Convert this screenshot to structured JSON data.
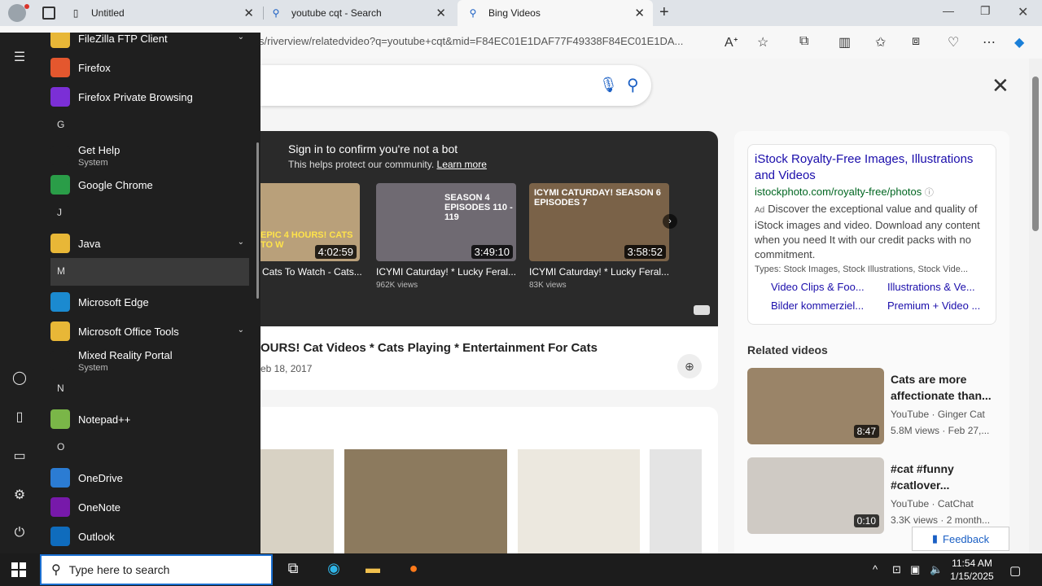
{
  "browser": {
    "tabs": [
      {
        "label": "Untitled",
        "icon": "page-icon"
      },
      {
        "label": "youtube cqt - Search",
        "icon": "search-icon"
      },
      {
        "label": "Bing Videos",
        "icon": "search-icon"
      }
    ],
    "url": "s/riverview/relatedvideo?q=youtube+cqt&mid=F84EC01E1DAF77F49338F84EC01E1DA..."
  },
  "player": {
    "bot_title": "Sign in to confirm you're not a bot",
    "bot_sub": "This helps protect our community.",
    "learn_more": "Learn more",
    "thumbs": [
      {
        "label": "EPIC 4 HOURS! CATS TO W",
        "duration": "4:02:59",
        "caption": "Cats To Watch - Cats...",
        "views": ""
      },
      {
        "label": "SEASON 4 EPISODES 110 - 119",
        "duration": "3:49:10",
        "caption": "ICYMI Caturday! * Lucky Feral...",
        "views": "962K views"
      },
      {
        "label": "ICYMI CATURDAY! SEASON 6 EPISODES 7",
        "duration": "3:58:52",
        "caption": "ICYMI Caturday! * Lucky Feral...",
        "views": "83K views"
      }
    ]
  },
  "video": {
    "title": "OURS! Cat Videos * Cats Playing * Entertainment For Cats",
    "date": "eb 18, 2017"
  },
  "ad": {
    "title": "iStock Royalty-Free Images, Illustrations and Videos",
    "url": "istockphoto.com/royalty-free/photos",
    "tag": "Ad",
    "desc": "Discover the exceptional value and quality of iStock images and video. Download any content when you need It with our credit packs with no commitment.",
    "types": "Types: Stock Images, Stock Illustrations, Stock Vide...",
    "links": [
      "Video Clips & Foo...",
      "Illustrations & Ve...",
      "Bilder kommerziel...",
      "Premium + Video ..."
    ]
  },
  "related": {
    "heading": "Related videos",
    "items": [
      {
        "title": "Cats are more affectionate than...",
        "source": "YouTube · Ginger Cat",
        "meta": "5.8M views · Feb 27,...",
        "duration": "8:47"
      },
      {
        "title": "#cat #funny #catlover...",
        "source": "YouTube · CatChat",
        "meta": "3.3K views · 2 month...",
        "duration": "0:10"
      }
    ]
  },
  "feedback": "Feedback",
  "start_menu": {
    "entries": [
      {
        "type": "app",
        "label": "FileZilla FTP Client",
        "sub": "",
        "icon": "folder-icon",
        "color": "#e8b737",
        "chevron": true
      },
      {
        "type": "app",
        "label": "Firefox",
        "sub": "",
        "icon": "firefox-icon",
        "color": "#e4572e",
        "chevron": false
      },
      {
        "type": "app",
        "label": "Firefox Private Browsing",
        "sub": "",
        "icon": "firefox-private-icon",
        "color": "#7b2fd6",
        "chevron": false
      },
      {
        "type": "letter",
        "label": "G"
      },
      {
        "type": "app",
        "label": "Get Help",
        "sub": "System",
        "icon": "get-help-icon",
        "color": "#1f1f1f",
        "chevron": false
      },
      {
        "type": "app",
        "label": "Google Chrome",
        "sub": "",
        "icon": "chrome-icon",
        "color": "#2a9d48",
        "chevron": false
      },
      {
        "type": "letter",
        "label": "J"
      },
      {
        "type": "app",
        "label": "Java",
        "sub": "",
        "icon": "folder-icon",
        "color": "#e8b737",
        "chevron": true
      },
      {
        "type": "letter",
        "label": "M",
        "highlight": true
      },
      {
        "type": "app",
        "label": "Microsoft Edge",
        "sub": "",
        "icon": "edge-icon",
        "color": "#1b8ad0",
        "chevron": false
      },
      {
        "type": "app",
        "label": "Microsoft Office Tools",
        "sub": "",
        "icon": "folder-icon",
        "color": "#e8b737",
        "chevron": true
      },
      {
        "type": "app",
        "label": "Mixed Reality Portal",
        "sub": "System",
        "icon": "mixed-reality-icon",
        "color": "#1f1f1f",
        "chevron": false
      },
      {
        "type": "letter",
        "label": "N"
      },
      {
        "type": "app",
        "label": "Notepad++",
        "sub": "",
        "icon": "notepadpp-icon",
        "color": "#7ab648",
        "chevron": false
      },
      {
        "type": "letter",
        "label": "O"
      },
      {
        "type": "app",
        "label": "OneDrive",
        "sub": "",
        "icon": "onedrive-icon",
        "color": "#2b7cd3",
        "chevron": false
      },
      {
        "type": "app",
        "label": "OneNote",
        "sub": "",
        "icon": "onenote-icon",
        "color": "#7719aa",
        "chevron": false
      },
      {
        "type": "app",
        "label": "Outlook",
        "sub": "",
        "icon": "outlook-icon",
        "color": "#0f6cbd",
        "chevron": false
      }
    ]
  },
  "taskbar": {
    "search_placeholder": "Type here to search",
    "time": "11:54 AM",
    "date": "1/15/2025"
  }
}
